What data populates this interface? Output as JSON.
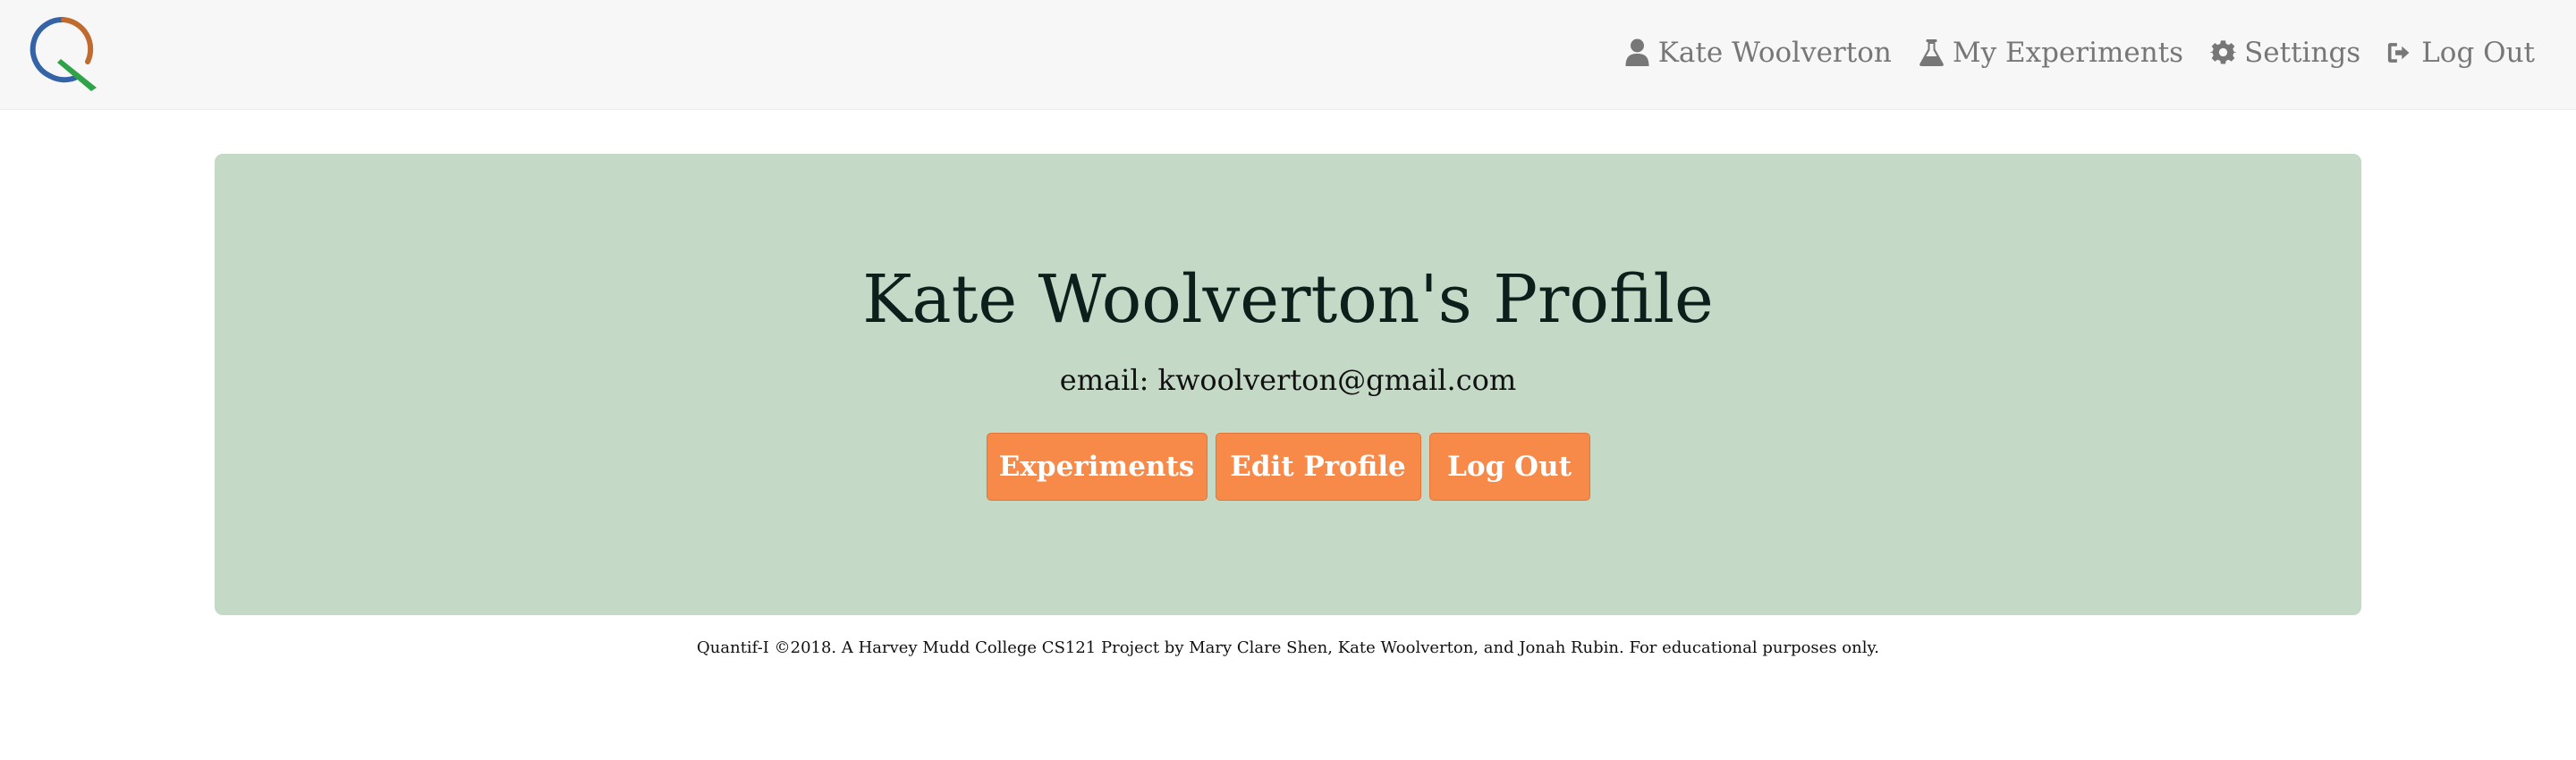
{
  "app": {
    "logo_icon": "quantif-i-logo-icon"
  },
  "nav": {
    "items": [
      {
        "label": "Kate Woolverton",
        "icon": "user-icon"
      },
      {
        "label": "My Experiments",
        "icon": "flask-icon"
      },
      {
        "label": "Settings",
        "icon": "gear-icon"
      },
      {
        "label": "Log Out",
        "icon": "sign-out-icon"
      }
    ]
  },
  "profile": {
    "title": "Kate Woolverton's Profile",
    "email": "email: kwoolverton@gmail.com",
    "buttons": {
      "experiments": "Experiments",
      "edit_profile": "Edit Profile",
      "log_out": "Log Out"
    }
  },
  "footer": {
    "text": "Quantif-I ©2018. A Harvey Mudd College CS121 Project by Mary Clare Shen, Kate Woolverton, and Jonah Rubin. For educational purposes only."
  },
  "colors": {
    "navbar_bg": "#f7f7f7",
    "nav_text": "#777777",
    "jumbotron_bg": "#c4dac7",
    "button_bg": "#f78a48",
    "button_text": "#ffffff"
  }
}
